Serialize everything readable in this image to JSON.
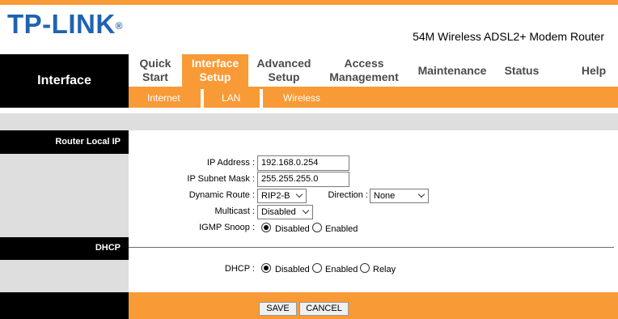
{
  "brand": {
    "logo": "TP-LINK",
    "reg": "®",
    "model": "54M Wireless ADSL2+ Modem Router"
  },
  "nav": {
    "section_title": "Interface",
    "items": [
      {
        "label": "Quick\nStart"
      },
      {
        "label": "Interface\nSetup"
      },
      {
        "label": "Advanced\nSetup"
      },
      {
        "label": "Access\nManagement"
      },
      {
        "label": "Maintenance"
      },
      {
        "label": "Status"
      },
      {
        "label": "Help"
      }
    ],
    "subitems": [
      {
        "label": "Internet"
      },
      {
        "label": "LAN"
      },
      {
        "label": "Wireless"
      }
    ]
  },
  "router_local_ip": {
    "header": "Router Local IP",
    "ip_label": "IP Address :",
    "ip_value": "192.168.0.254",
    "mask_label": "IP Subnet Mask :",
    "mask_value": "255.255.255.0",
    "dyn_label": "Dynamic Route :",
    "dyn_value": "RIP2-B",
    "dir_label": "Direction :",
    "dir_value": "None",
    "mcast_label": "Multicast :",
    "mcast_value": "Disabled",
    "igmp_label": "IGMP Snoop :",
    "igmp_disabled": "Disabled",
    "igmp_enabled": "Enabled",
    "igmp_selected": "Disabled"
  },
  "dhcp": {
    "header": "DHCP",
    "label": "DHCP :",
    "opt_disabled": "Disabled",
    "opt_enabled": "Enabled",
    "opt_relay": "Relay",
    "selected": "Disabled"
  },
  "buttons": {
    "save": "SAVE",
    "cancel": "CANCEL"
  },
  "colors": {
    "orange": "#f89a36",
    "blue": "#1e63b3",
    "black": "#000000",
    "gray": "#dedede"
  }
}
